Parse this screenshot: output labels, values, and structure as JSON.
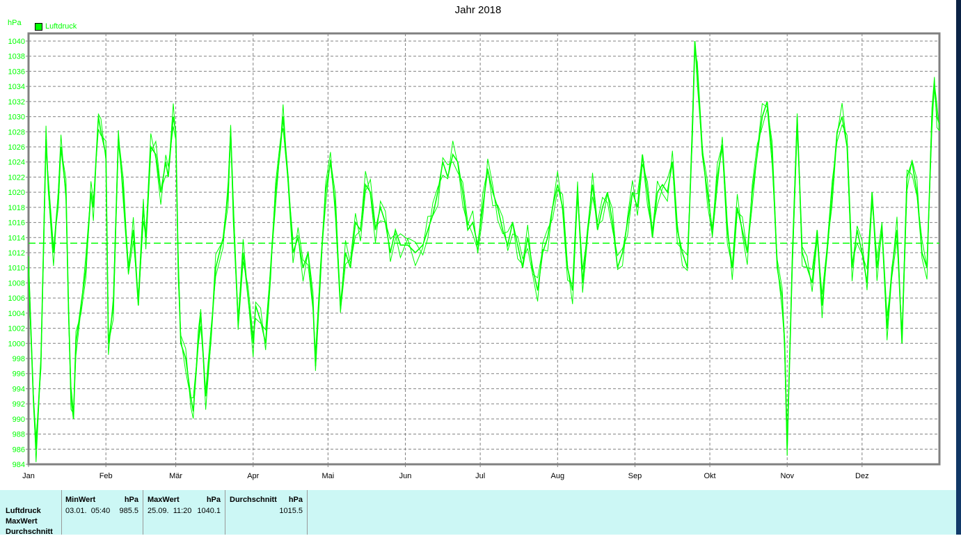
{
  "chart_data": {
    "type": "line",
    "title": "Jahr 2018",
    "ylabel": "hPa",
    "xlabel": "",
    "ylim": [
      984,
      1040
    ],
    "xlim_days": [
      0,
      365
    ],
    "yticks": [
      984,
      986,
      988,
      990,
      992,
      994,
      996,
      998,
      1000,
      1002,
      1004,
      1006,
      1008,
      1010,
      1012,
      1014,
      1016,
      1018,
      1020,
      1022,
      1024,
      1026,
      1028,
      1030,
      1032,
      1034,
      1036,
      1038,
      1040
    ],
    "xticks": [
      {
        "label": "Jan",
        "day": 0
      },
      {
        "label": "Feb",
        "day": 31
      },
      {
        "label": "Mär",
        "day": 59
      },
      {
        "label": "Apr",
        "day": 90
      },
      {
        "label": "Mai",
        "day": 120
      },
      {
        "label": "Jun",
        "day": 151
      },
      {
        "label": "Jul",
        "day": 181
      },
      {
        "label": "Aug",
        "day": 212
      },
      {
        "label": "Sep",
        "day": 243
      },
      {
        "label": "Okt",
        "day": 273
      },
      {
        "label": "Nov",
        "day": 304
      },
      {
        "label": "Dez",
        "day": 334
      }
    ],
    "grid": true,
    "legend": {
      "position": "top-left",
      "entries": [
        "Luftdruck"
      ]
    },
    "reference_line": {
      "value": 1013.25,
      "style": "dashed"
    },
    "colors": {
      "series": "#00ff00",
      "grid": "#808080",
      "frame": "#808080"
    },
    "series": [
      {
        "name": "Luftdruck",
        "x": [
          0,
          2,
          3,
          5,
          7,
          8,
          10,
          12,
          13,
          15,
          16,
          17,
          18,
          19,
          21,
          23,
          25,
          26,
          28,
          29,
          31,
          32,
          34,
          36,
          38,
          40,
          42,
          44,
          46,
          47,
          49,
          51,
          53,
          55,
          56,
          58,
          59,
          60,
          61,
          63,
          65,
          66,
          68,
          69,
          71,
          73,
          75,
          78,
          80,
          81,
          82,
          84,
          86,
          88,
          90,
          91,
          93,
          95,
          97,
          99,
          101,
          102,
          104,
          106,
          108,
          110,
          112,
          114,
          115,
          117,
          119,
          121,
          123,
          125,
          127,
          129,
          131,
          133,
          135,
          137,
          139,
          141,
          143,
          145,
          147,
          149,
          152,
          155,
          158,
          160,
          162,
          164,
          166,
          168,
          170,
          172,
          174,
          176,
          178,
          180,
          182,
          184,
          186,
          188,
          190,
          192,
          194,
          196,
          198,
          200,
          202,
          204,
          206,
          208,
          210,
          212,
          214,
          216,
          218,
          220,
          222,
          224,
          226,
          228,
          230,
          232,
          234,
          236,
          238,
          240,
          242,
          244,
          246,
          248,
          250,
          252,
          254,
          256,
          258,
          260,
          262,
          264,
          266,
          267,
          268,
          270,
          272,
          274,
          276,
          278,
          280,
          282,
          284,
          286,
          288,
          290,
          292,
          294,
          296,
          298,
          300,
          302,
          303,
          304,
          306,
          308,
          310,
          312,
          314,
          316,
          318,
          320,
          322,
          324,
          326,
          328,
          330,
          332,
          334,
          336,
          338,
          340,
          342,
          344,
          346,
          348,
          350,
          352,
          354,
          356,
          358,
          360,
          362,
          363,
          364,
          365
        ],
        "values": [
          1010,
          992,
          986,
          998,
          1027,
          1020,
          1012,
          1020,
          1026,
          1020,
          1005,
          993,
          990,
          1000,
          1005,
          1010,
          1020,
          1018,
          1030,
          1028,
          1025,
          1000,
          1005,
          1027,
          1020,
          1010,
          1015,
          1005,
          1018,
          1014,
          1026,
          1025,
          1020,
          1024,
          1022,
          1030,
          1028,
          1010,
          1000,
          998,
          993,
          991,
          1000,
          1004,
          993,
          1000,
          1010,
          1014,
          1020,
          1028,
          1018,
          1003,
          1012,
          1006,
          1000,
          1005,
          1003,
          1000,
          1010,
          1020,
          1026,
          1030,
          1022,
          1012,
          1014,
          1010,
          1012,
          1005,
          997,
          1010,
          1020,
          1024,
          1018,
          1005,
          1012,
          1010,
          1016,
          1015,
          1021,
          1020,
          1015,
          1018,
          1016,
          1012,
          1015,
          1013,
          1013,
          1012,
          1013,
          1015,
          1017,
          1020,
          1024,
          1022,
          1025,
          1024,
          1020,
          1015,
          1016,
          1013,
          1018,
          1023,
          1020,
          1018,
          1015,
          1013,
          1016,
          1013,
          1010,
          1014,
          1010,
          1007,
          1012,
          1014,
          1018,
          1021,
          1018,
          1010,
          1007,
          1020,
          1008,
          1015,
          1021,
          1015,
          1018,
          1020,
          1016,
          1010,
          1012,
          1016,
          1020,
          1018,
          1025,
          1020,
          1014,
          1020,
          1021,
          1020,
          1024,
          1015,
          1012,
          1010,
          1028,
          1040,
          1036,
          1025,
          1020,
          1015,
          1022,
          1026,
          1015,
          1010,
          1018,
          1015,
          1012,
          1020,
          1025,
          1030,
          1032,
          1025,
          1010,
          1006,
          1000,
          986,
          1010,
          1030,
          1012,
          1010,
          1008,
          1015,
          1005,
          1012,
          1020,
          1028,
          1030,
          1026,
          1010,
          1015,
          1012,
          1008,
          1020,
          1010,
          1015,
          1002,
          1010,
          1015,
          1000,
          1022,
          1024,
          1020,
          1012,
          1010,
          1030,
          1034,
          1030,
          1029
        ]
      }
    ]
  },
  "stats": {
    "row_labels": [
      "Luftdruck",
      "MaxWert",
      "Durchschnitt"
    ],
    "min": {
      "header": "MinWert",
      "unit": "hPa",
      "time": "03.01.  05:40",
      "value": "985.5"
    },
    "max": {
      "header": "MaxWert",
      "unit": "hPa",
      "time": "25.09.  11:20",
      "value": "1040.1"
    },
    "avg": {
      "header": "Durchschnitt",
      "unit": "hPa",
      "value": "1015.5"
    }
  }
}
